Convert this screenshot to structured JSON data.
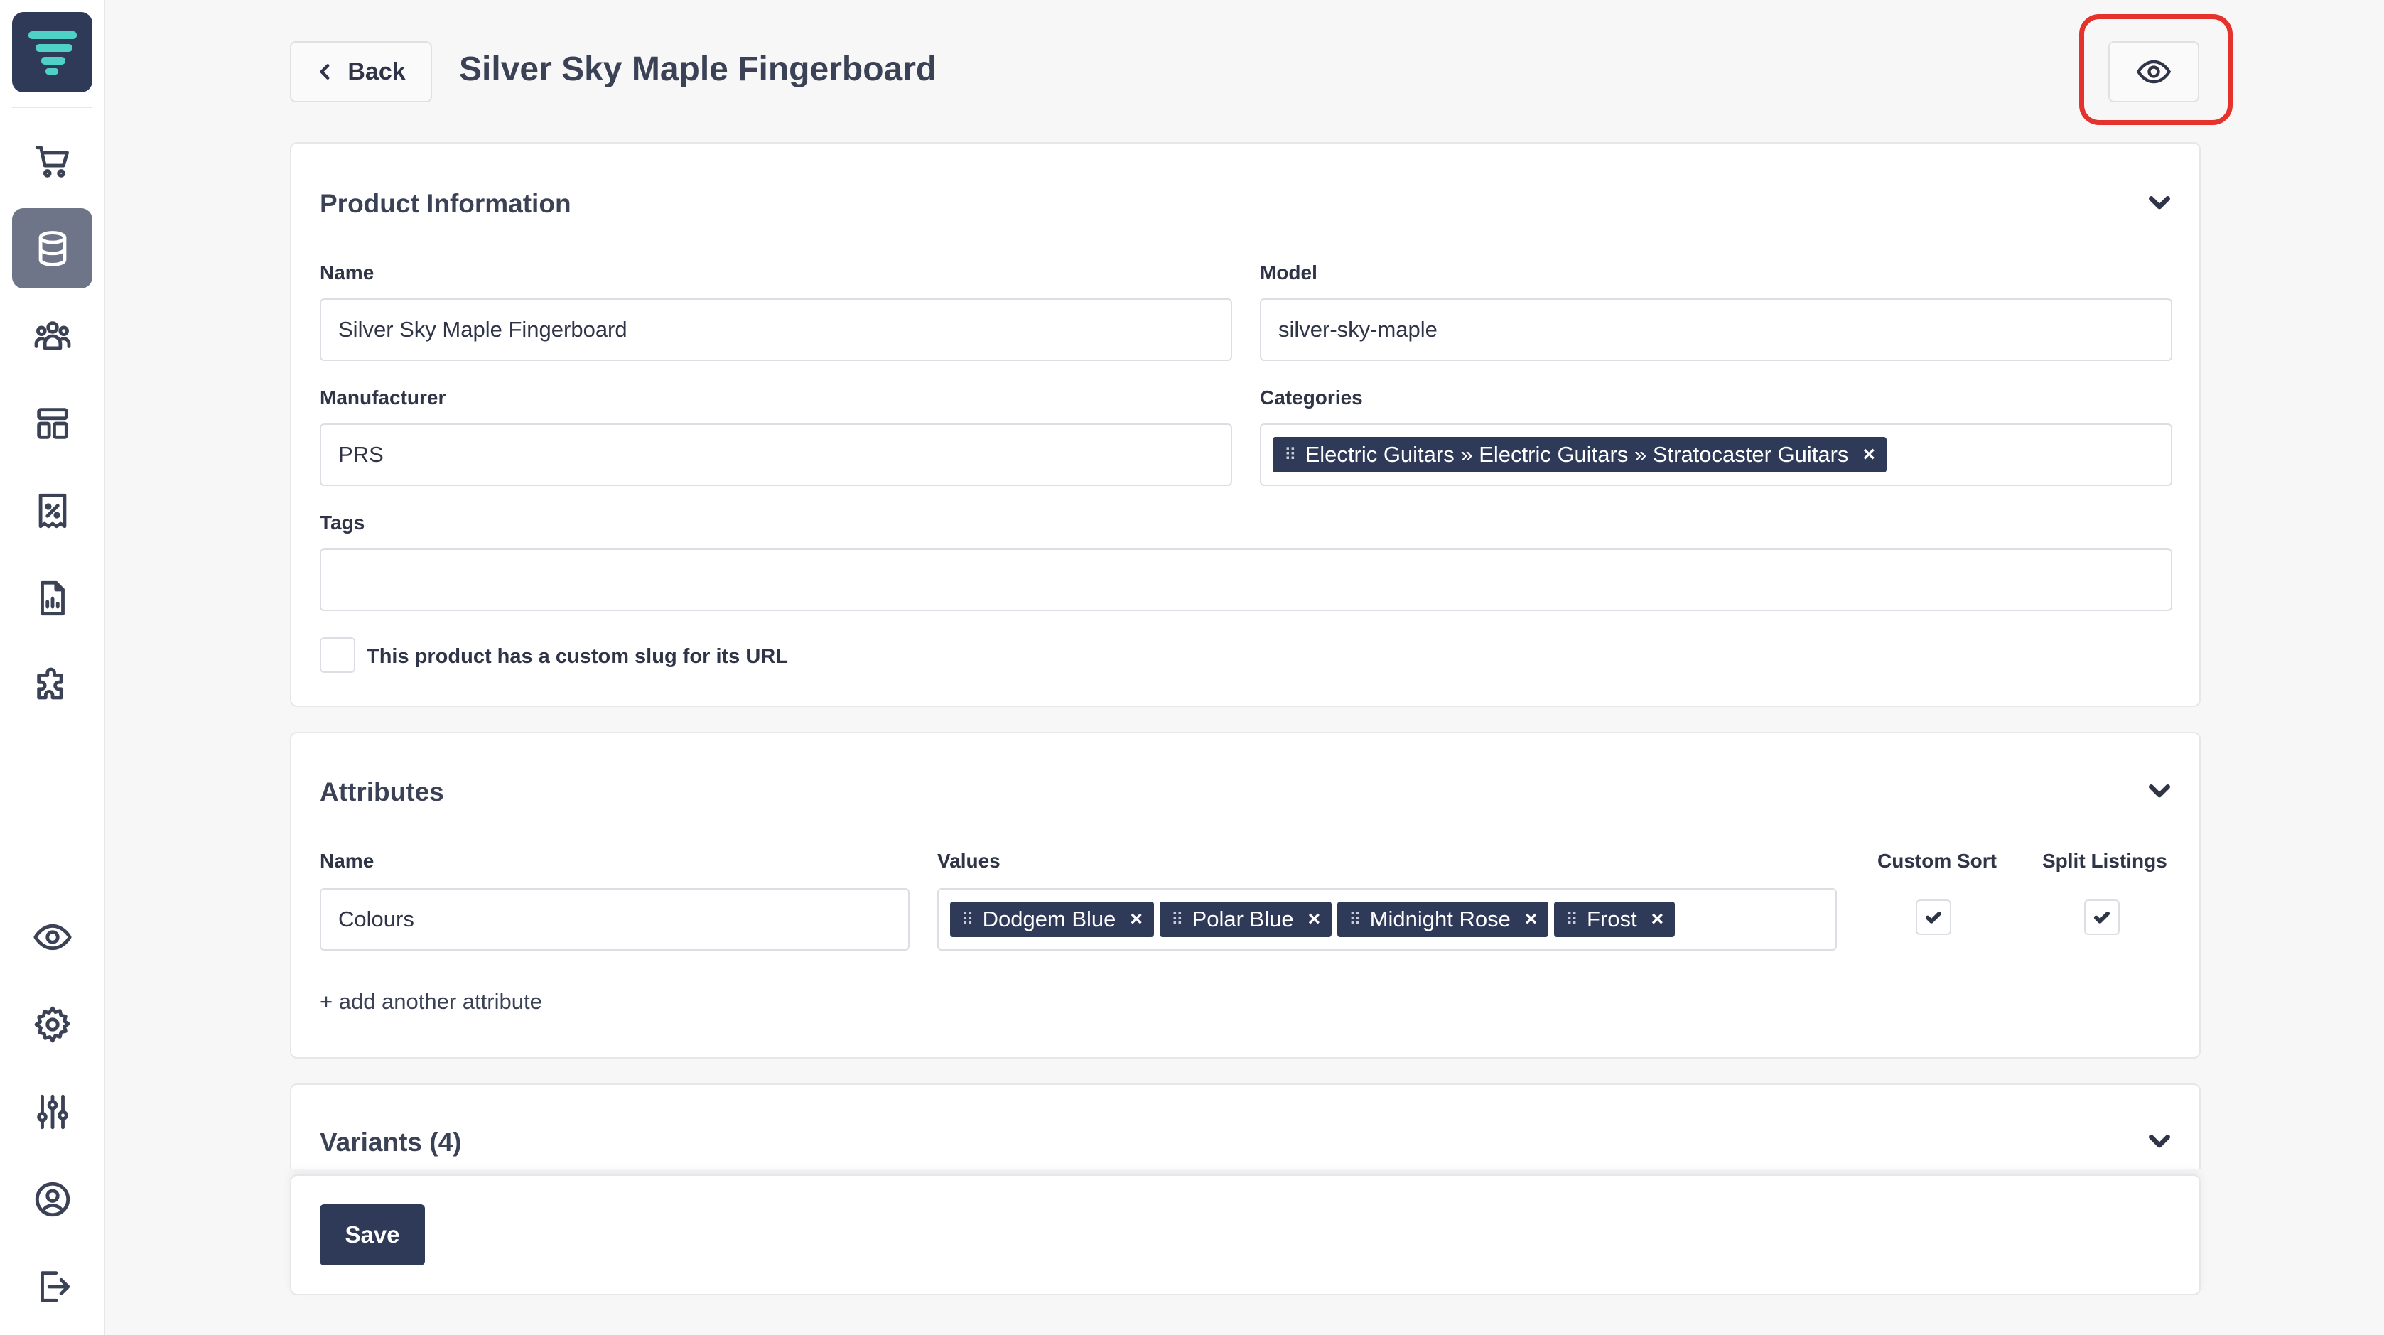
{
  "header": {
    "back_label": "Back",
    "title": "Silver Sky Maple Fingerboard"
  },
  "sidebar": {
    "items": [
      {
        "icon": "cart-icon"
      },
      {
        "icon": "database-icon",
        "active": true
      },
      {
        "icon": "users-icon"
      },
      {
        "icon": "layout-icon"
      },
      {
        "icon": "receipt-icon"
      },
      {
        "icon": "report-icon"
      },
      {
        "icon": "puzzle-icon"
      },
      {
        "icon": "eye-icon"
      },
      {
        "icon": "gear-icon"
      },
      {
        "icon": "sliders-icon"
      },
      {
        "icon": "user-circle-icon"
      },
      {
        "icon": "logout-icon"
      }
    ]
  },
  "product_info": {
    "title": "Product Information",
    "name_label": "Name",
    "name_value": "Silver Sky Maple Fingerboard",
    "model_label": "Model",
    "model_value": "silver-sky-maple",
    "manufacturer_label": "Manufacturer",
    "manufacturer_value": "PRS",
    "categories_label": "Categories",
    "categories": [
      "Electric Guitars » Electric Guitars » Stratocaster Guitars"
    ],
    "tags_label": "Tags",
    "tags_value": "",
    "custom_slug_label": "This product has a custom slug for its URL",
    "custom_slug_checked": false
  },
  "attributes": {
    "title": "Attributes",
    "name_label": "Name",
    "values_label": "Values",
    "custom_sort_label": "Custom Sort",
    "split_listings_label": "Split Listings",
    "rows": [
      {
        "name": "Colours",
        "values": [
          "Dodgem Blue",
          "Polar Blue",
          "Midnight Rose",
          "Frost"
        ],
        "custom_sort": true,
        "split_listings": true
      }
    ],
    "add_label": "+ add another attribute"
  },
  "variants": {
    "title": "Variants (4)"
  },
  "footer": {
    "save_label": "Save"
  },
  "colors": {
    "accent": "#2f3a58",
    "highlight": "#e5322d",
    "background": "#f7f7f8"
  }
}
